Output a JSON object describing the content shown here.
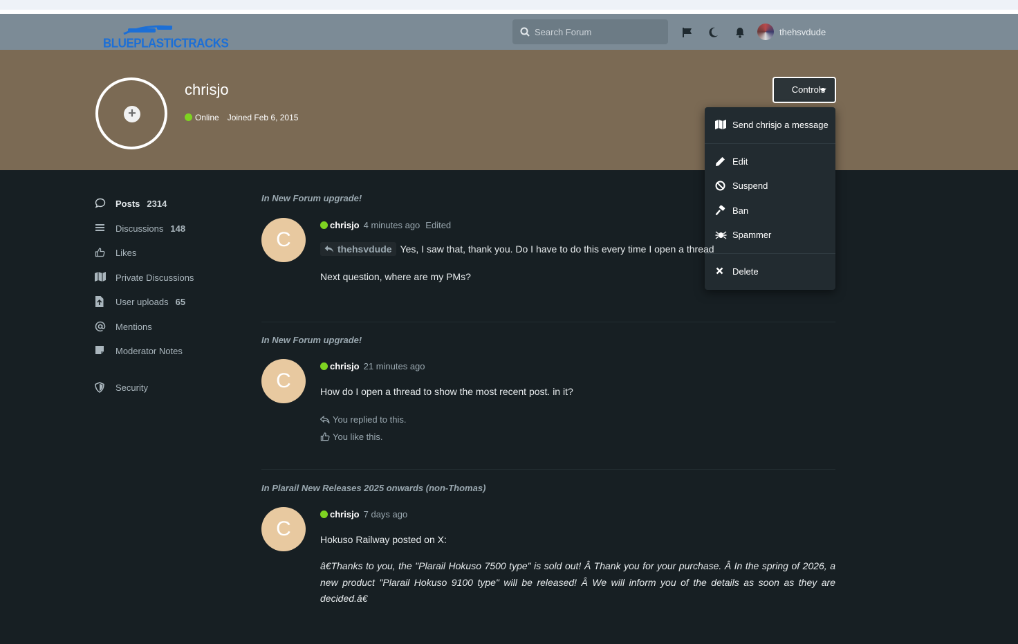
{
  "header": {
    "logo_text": "BLUEPLASTICTRACKS",
    "search_placeholder": "Search Forum",
    "username": "thehsvdude"
  },
  "profile": {
    "name": "chrisjo",
    "status": "Online",
    "joined": "Joined Feb 6, 2015",
    "controls_label": "Controls"
  },
  "controls_menu": {
    "items": [
      {
        "label": "Send chrisjo a message",
        "icon": "map-icon"
      },
      {
        "label": "Edit",
        "icon": "pencil-icon"
      },
      {
        "label": "Suspend",
        "icon": "ban-circle-icon"
      },
      {
        "label": "Ban",
        "icon": "hammer-icon"
      },
      {
        "label": "Spammer",
        "icon": "spider-icon"
      },
      {
        "label": "Delete",
        "icon": "x-icon"
      }
    ]
  },
  "sidebar": {
    "items": [
      {
        "label": "Posts",
        "count": "2314",
        "icon": "comment-icon"
      },
      {
        "label": "Discussions",
        "count": "148",
        "icon": "list-icon"
      },
      {
        "label": "Likes",
        "count": "",
        "icon": "thumbs-up-icon"
      },
      {
        "label": "Private Discussions",
        "count": "",
        "icon": "map-icon"
      },
      {
        "label": "User uploads",
        "count": "65",
        "icon": "file-upload-icon"
      },
      {
        "label": "Mentions",
        "count": "",
        "icon": "at-icon"
      },
      {
        "label": "Moderator Notes",
        "count": "",
        "icon": "note-icon"
      },
      {
        "label": "Security",
        "count": "",
        "icon": "shield-icon"
      }
    ]
  },
  "posts": [
    {
      "context_prefix": "In",
      "discussion": "New Forum upgrade!",
      "avatar_letter": "C",
      "author": "chrisjo",
      "time": "4 minutes ago",
      "edited": "Edited",
      "mention": "thehsvdude",
      "line1": "Yes, I saw that, thank you. Do I have to do this every time I open a thread",
      "line2": "Next question, where are my PMs?"
    },
    {
      "context_prefix": "In",
      "discussion": "New Forum upgrade!",
      "avatar_letter": "C",
      "author": "chrisjo",
      "time": "21 minutes ago",
      "line1": "How do I open a thread to show the most recent post. in it?",
      "replied_note": "You replied to this.",
      "like_note": "You like this."
    },
    {
      "context_prefix": "In",
      "discussion": "Plarail New Releases 2025 onwards (non-Thomas)",
      "avatar_letter": "C",
      "author": "chrisjo",
      "time": "7 days ago",
      "line1": "Hokuso Railway posted on X:",
      "quote": "â€Thanks to you, the \"Plarail Hokuso 7500 type\" is sold out! Â Thank you for your purchase. Â In the spring of 2026, a new product \"Plarail Hokuso 9100 type\" will be released! Â We will inform you of the details as soon as they are decided.â€"
    }
  ],
  "colors": {
    "header_bg": "#7c8b96",
    "hero_bg": "#7b6a54",
    "page_bg": "#171f23",
    "online": "#7ed321",
    "avatar_bg": "#e8c9a0"
  }
}
